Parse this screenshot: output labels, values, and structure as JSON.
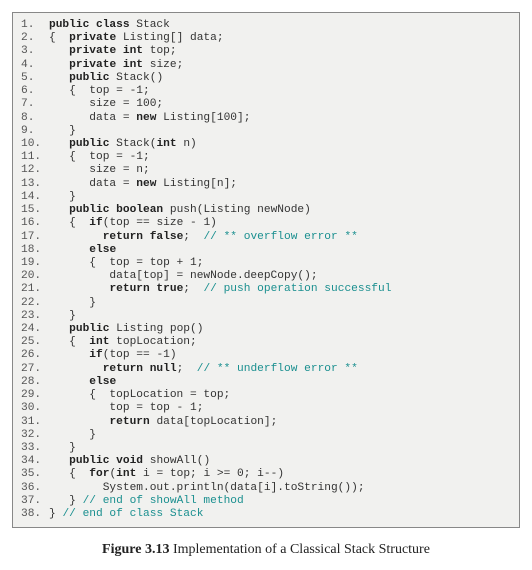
{
  "caption_label": "Figure 3.13",
  "caption_text": " Implementation of a Classical Stack Structure",
  "code": {
    "lines": [
      {
        "n": "1.",
        "indent": "",
        "tokens": [
          [
            "kw",
            "public class"
          ],
          [
            "",
            " Stack"
          ]
        ]
      },
      {
        "n": "2.",
        "indent": "",
        "tokens": [
          [
            "",
            "{  "
          ],
          [
            "kw",
            "private"
          ],
          [
            "",
            " Listing[] data;"
          ]
        ]
      },
      {
        "n": "3.",
        "indent": "   ",
        "tokens": [
          [
            "kw",
            "private int"
          ],
          [
            "",
            " top;"
          ]
        ]
      },
      {
        "n": "4.",
        "indent": "   ",
        "tokens": [
          [
            "kw",
            "private int"
          ],
          [
            "",
            " size;"
          ]
        ]
      },
      {
        "n": "5.",
        "indent": "   ",
        "tokens": [
          [
            "kw",
            "public"
          ],
          [
            "",
            " Stack()"
          ]
        ]
      },
      {
        "n": "6.",
        "indent": "   ",
        "tokens": [
          [
            "",
            "{  top = -1;"
          ]
        ]
      },
      {
        "n": "7.",
        "indent": "      ",
        "tokens": [
          [
            "",
            "size = 100;"
          ]
        ]
      },
      {
        "n": "8.",
        "indent": "      ",
        "tokens": [
          [
            "",
            "data = "
          ],
          [
            "kw",
            "new"
          ],
          [
            "",
            " Listing[100];"
          ]
        ]
      },
      {
        "n": "9.",
        "indent": "   ",
        "tokens": [
          [
            "",
            "}"
          ]
        ]
      },
      {
        "n": "10.",
        "indent": "   ",
        "tokens": [
          [
            "kw",
            "public"
          ],
          [
            "",
            " Stack("
          ],
          [
            "kw",
            "int"
          ],
          [
            "",
            " n)"
          ]
        ]
      },
      {
        "n": "11.",
        "indent": "   ",
        "tokens": [
          [
            "",
            "{  top = -1;"
          ]
        ]
      },
      {
        "n": "12.",
        "indent": "      ",
        "tokens": [
          [
            "",
            "size = n;"
          ]
        ]
      },
      {
        "n": "13.",
        "indent": "      ",
        "tokens": [
          [
            "",
            "data = "
          ],
          [
            "kw",
            "new"
          ],
          [
            "",
            " Listing[n];"
          ]
        ]
      },
      {
        "n": "14.",
        "indent": "   ",
        "tokens": [
          [
            "",
            "}"
          ]
        ]
      },
      {
        "n": "15.",
        "indent": "   ",
        "tokens": [
          [
            "kw",
            "public boolean"
          ],
          [
            "",
            " push(Listing newNode)"
          ]
        ]
      },
      {
        "n": "16.",
        "indent": "   ",
        "tokens": [
          [
            "",
            "{  "
          ],
          [
            "kw",
            "if"
          ],
          [
            "",
            "(top == size - 1)"
          ]
        ]
      },
      {
        "n": "17.",
        "indent": "        ",
        "tokens": [
          [
            "kw",
            "return false"
          ],
          [
            "",
            ";  "
          ],
          [
            "cm",
            "// ** overflow error **"
          ]
        ]
      },
      {
        "n": "18.",
        "indent": "      ",
        "tokens": [
          [
            "kw",
            "else"
          ]
        ]
      },
      {
        "n": "19.",
        "indent": "      ",
        "tokens": [
          [
            "",
            "{  top = top + 1;"
          ]
        ]
      },
      {
        "n": "20.",
        "indent": "         ",
        "tokens": [
          [
            "",
            "data[top] = newNode.deepCopy();"
          ]
        ]
      },
      {
        "n": "21.",
        "indent": "         ",
        "tokens": [
          [
            "kw",
            "return true"
          ],
          [
            "",
            ";  "
          ],
          [
            "cm",
            "// push operation successful"
          ]
        ]
      },
      {
        "n": "22.",
        "indent": "      ",
        "tokens": [
          [
            "",
            "}"
          ]
        ]
      },
      {
        "n": "23.",
        "indent": "   ",
        "tokens": [
          [
            "",
            "}"
          ]
        ]
      },
      {
        "n": "24.",
        "indent": "   ",
        "tokens": [
          [
            "kw",
            "public"
          ],
          [
            "",
            " Listing pop()"
          ]
        ]
      },
      {
        "n": "25.",
        "indent": "   ",
        "tokens": [
          [
            "",
            "{  "
          ],
          [
            "kw",
            "int"
          ],
          [
            "",
            " topLocation;"
          ]
        ]
      },
      {
        "n": "26.",
        "indent": "      ",
        "tokens": [
          [
            "kw",
            "if"
          ],
          [
            "",
            "(top == -1)"
          ]
        ]
      },
      {
        "n": "27.",
        "indent": "        ",
        "tokens": [
          [
            "kw",
            "return null"
          ],
          [
            "",
            ";  "
          ],
          [
            "cm",
            "// ** underflow error **"
          ]
        ]
      },
      {
        "n": "28.",
        "indent": "      ",
        "tokens": [
          [
            "kw",
            "else"
          ]
        ]
      },
      {
        "n": "29.",
        "indent": "      ",
        "tokens": [
          [
            "",
            "{  topLocation = top;"
          ]
        ]
      },
      {
        "n": "30.",
        "indent": "         ",
        "tokens": [
          [
            "",
            "top = top - 1;"
          ]
        ]
      },
      {
        "n": "31.",
        "indent": "         ",
        "tokens": [
          [
            "kw",
            "return"
          ],
          [
            "",
            " data[topLocation];"
          ]
        ]
      },
      {
        "n": "32.",
        "indent": "      ",
        "tokens": [
          [
            "",
            "}"
          ]
        ]
      },
      {
        "n": "33.",
        "indent": "   ",
        "tokens": [
          [
            "",
            "}"
          ]
        ]
      },
      {
        "n": "34.",
        "indent": "   ",
        "tokens": [
          [
            "kw",
            "public void"
          ],
          [
            "",
            " showAll()"
          ]
        ]
      },
      {
        "n": "35.",
        "indent": "   ",
        "tokens": [
          [
            "",
            "{  "
          ],
          [
            "kw",
            "for"
          ],
          [
            "",
            "("
          ],
          [
            "kw",
            "int"
          ],
          [
            "",
            " i = top; i >= 0; i--)"
          ]
        ]
      },
      {
        "n": "36.",
        "indent": "        ",
        "tokens": [
          [
            "",
            "System.out.println(data[i].toString());"
          ]
        ]
      },
      {
        "n": "37.",
        "indent": "   ",
        "tokens": [
          [
            "",
            "} "
          ],
          [
            "cm",
            "// end of showAll method"
          ]
        ]
      },
      {
        "n": "38.",
        "indent": "",
        "tokens": [
          [
            "",
            "} "
          ],
          [
            "cm",
            "// end of class Stack"
          ]
        ]
      }
    ]
  }
}
